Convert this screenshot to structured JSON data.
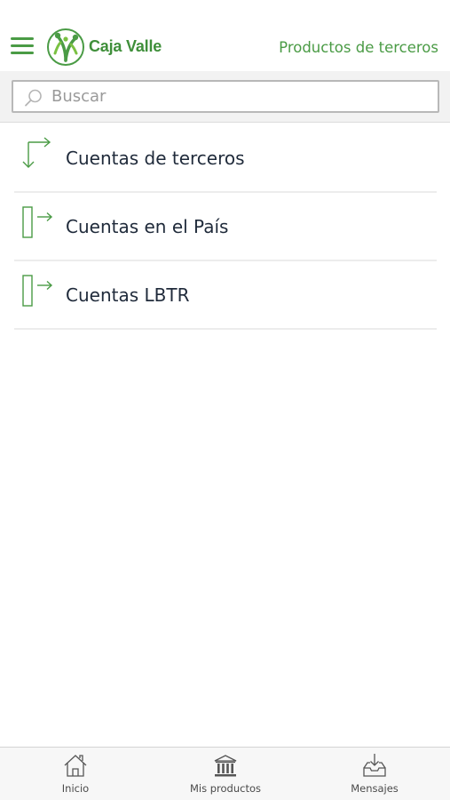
{
  "header": {
    "brand": "Caja Valle",
    "title": "Productos de terceros",
    "menu_icon": "hamburger-menu-icon",
    "logo_icon": "caja-valle-logo"
  },
  "search": {
    "placeholder": "Buscar",
    "value": "",
    "icon": "search-icon"
  },
  "list": {
    "items": [
      {
        "label": "Cuentas de terceros",
        "icon": "transfer-arrows-icon"
      },
      {
        "label": "Cuentas en el País",
        "icon": "account-arrow-icon"
      },
      {
        "label": "Cuentas LBTR",
        "icon": "account-arrow-icon"
      }
    ]
  },
  "bottom_nav": {
    "items": [
      {
        "label": "Inicio",
        "icon": "home-icon"
      },
      {
        "label": "Mis productos",
        "icon": "bank-icon"
      },
      {
        "label": "Mensajes",
        "icon": "inbox-icon"
      }
    ]
  },
  "colors": {
    "accent": "#4a9b45",
    "brand_text": "#3f8f3a",
    "text": "#1f2a3a",
    "divider": "#ececec",
    "search_bar_bg": "#f2f2f2",
    "nav_bg": "#f7f7f7"
  }
}
